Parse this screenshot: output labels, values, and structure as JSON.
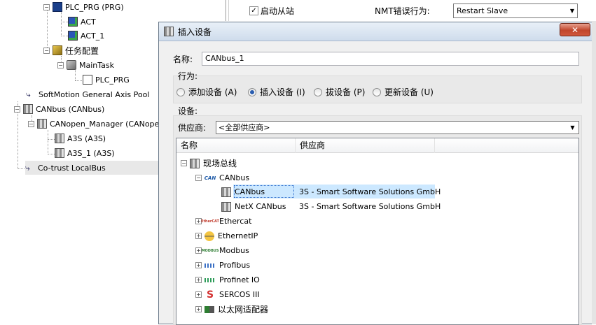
{
  "project_tree": {
    "items": [
      {
        "label": "PLC_PRG (PRG)",
        "icon": "program-icon"
      },
      {
        "label": "ACT",
        "icon": "action-icon"
      },
      {
        "label": "ACT_1",
        "icon": "action-icon"
      },
      {
        "label": "任务配置",
        "icon": "task-config-icon"
      },
      {
        "label": "MainTask",
        "icon": "task-icon"
      },
      {
        "label": "PLC_PRG",
        "icon": "program-call-icon"
      },
      {
        "label": "SoftMotion General Axis Pool",
        "icon": "axis-pool-icon"
      },
      {
        "label": "CANbus (CANbus)",
        "icon": "device-icon"
      },
      {
        "label": "CANopen_Manager (CANopen_",
        "icon": "device-icon"
      },
      {
        "label": "A3S (A3S)",
        "icon": "device-icon"
      },
      {
        "label": "A3S_1 (A3S)",
        "icon": "device-icon"
      },
      {
        "label": "Co-trust LocalBus",
        "icon": "localbus-icon"
      }
    ]
  },
  "editor": {
    "start_slave_label": "启动从站",
    "start_slave_checked": true,
    "nmt_label": "NMT错误行为:",
    "nmt_value": "Restart Slave"
  },
  "dialog": {
    "title": "插入设备",
    "close_glyph": "✕",
    "name_label": "名称:",
    "name_value": "CANbus_1",
    "action_label": "行为:",
    "actions": [
      {
        "label": "添加设备 (A)",
        "selected": false
      },
      {
        "label": "插入设备 (I)",
        "selected": true
      },
      {
        "label": "拔设备 (P)",
        "selected": false
      },
      {
        "label": "更新设备 (U)",
        "selected": false
      }
    ],
    "devices_label": "设备:",
    "vendor_label": "供应商:",
    "vendor_value": "<全部供应商>",
    "columns": [
      "名称",
      "供应商"
    ],
    "tree": [
      {
        "label": "现场总线",
        "level": 0,
        "expanded": true,
        "icon": "fieldbus-icon",
        "vendor": ""
      },
      {
        "label": "CANbus",
        "level": 1,
        "expanded": true,
        "icon": "can-icon",
        "icon_text": "CAN",
        "vendor": ""
      },
      {
        "label": "CANbus",
        "level": 2,
        "icon": "device-icon",
        "vendor": "3S - Smart Software Solutions GmbH",
        "selected": true
      },
      {
        "label": "NetX CANbus",
        "level": 2,
        "icon": "device-icon",
        "vendor": "3S - Smart Software Solutions GmbH"
      },
      {
        "label": "Ethercat",
        "level": 1,
        "expanded": false,
        "icon": "ethercat-icon",
        "icon_text": "EtherCAT",
        "vendor": ""
      },
      {
        "label": "EthernetIP",
        "level": 1,
        "expanded": false,
        "icon": "ethernetip-icon",
        "vendor": ""
      },
      {
        "label": "Modbus",
        "level": 1,
        "expanded": false,
        "icon": "modbus-icon",
        "icon_text": "MODBUS",
        "vendor": ""
      },
      {
        "label": "Profibus",
        "level": 1,
        "expanded": false,
        "icon": "profibus-icon",
        "vendor": ""
      },
      {
        "label": "Profinet IO",
        "level": 1,
        "expanded": false,
        "icon": "profinet-icon",
        "vendor": ""
      },
      {
        "label": "SERCOS III",
        "level": 1,
        "expanded": false,
        "icon": "sercos-icon",
        "icon_text": "S",
        "vendor": ""
      },
      {
        "label": "以太网适配器",
        "level": 1,
        "expanded": false,
        "icon": "ethernet-adapter-icon",
        "vendor": ""
      }
    ]
  }
}
